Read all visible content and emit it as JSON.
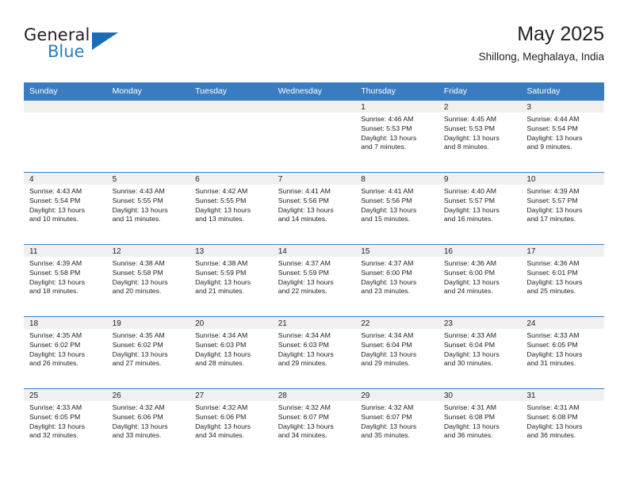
{
  "logo": {
    "word_top": "General",
    "word_bottom": "Blue",
    "triangle_color": "#1c6cb5",
    "blue_text_color": "#2b7cc1"
  },
  "header": {
    "title": "May 2025",
    "location": "Shillong, Meghalaya, India"
  },
  "theme": {
    "header_blue": "#3a7cc0",
    "daynum_strip_gray": "#f0f0f0",
    "text_color": "#222222"
  },
  "weekdays": [
    "Sunday",
    "Monday",
    "Tuesday",
    "Wednesday",
    "Thursday",
    "Friday",
    "Saturday"
  ],
  "weeks": [
    [
      {
        "day": "",
        "sunrise": "",
        "sunset": "",
        "daylight_line1": "",
        "daylight_line2": ""
      },
      {
        "day": "",
        "sunrise": "",
        "sunset": "",
        "daylight_line1": "",
        "daylight_line2": ""
      },
      {
        "day": "",
        "sunrise": "",
        "sunset": "",
        "daylight_line1": "",
        "daylight_line2": ""
      },
      {
        "day": "",
        "sunrise": "",
        "sunset": "",
        "daylight_line1": "",
        "daylight_line2": ""
      },
      {
        "day": "1",
        "sunrise": "Sunrise: 4:46 AM",
        "sunset": "Sunset: 5:53 PM",
        "daylight_line1": "Daylight: 13 hours",
        "daylight_line2": "and 7 minutes."
      },
      {
        "day": "2",
        "sunrise": "Sunrise: 4:45 AM",
        "sunset": "Sunset: 5:53 PM",
        "daylight_line1": "Daylight: 13 hours",
        "daylight_line2": "and 8 minutes."
      },
      {
        "day": "3",
        "sunrise": "Sunrise: 4:44 AM",
        "sunset": "Sunset: 5:54 PM",
        "daylight_line1": "Daylight: 13 hours",
        "daylight_line2": "and 9 minutes."
      }
    ],
    [
      {
        "day": "4",
        "sunrise": "Sunrise: 4:43 AM",
        "sunset": "Sunset: 5:54 PM",
        "daylight_line1": "Daylight: 13 hours",
        "daylight_line2": "and 10 minutes."
      },
      {
        "day": "5",
        "sunrise": "Sunrise: 4:43 AM",
        "sunset": "Sunset: 5:55 PM",
        "daylight_line1": "Daylight: 13 hours",
        "daylight_line2": "and 11 minutes."
      },
      {
        "day": "6",
        "sunrise": "Sunrise: 4:42 AM",
        "sunset": "Sunset: 5:55 PM",
        "daylight_line1": "Daylight: 13 hours",
        "daylight_line2": "and 13 minutes."
      },
      {
        "day": "7",
        "sunrise": "Sunrise: 4:41 AM",
        "sunset": "Sunset: 5:56 PM",
        "daylight_line1": "Daylight: 13 hours",
        "daylight_line2": "and 14 minutes."
      },
      {
        "day": "8",
        "sunrise": "Sunrise: 4:41 AM",
        "sunset": "Sunset: 5:56 PM",
        "daylight_line1": "Daylight: 13 hours",
        "daylight_line2": "and 15 minutes."
      },
      {
        "day": "9",
        "sunrise": "Sunrise: 4:40 AM",
        "sunset": "Sunset: 5:57 PM",
        "daylight_line1": "Daylight: 13 hours",
        "daylight_line2": "and 16 minutes."
      },
      {
        "day": "10",
        "sunrise": "Sunrise: 4:39 AM",
        "sunset": "Sunset: 5:57 PM",
        "daylight_line1": "Daylight: 13 hours",
        "daylight_line2": "and 17 minutes."
      }
    ],
    [
      {
        "day": "11",
        "sunrise": "Sunrise: 4:39 AM",
        "sunset": "Sunset: 5:58 PM",
        "daylight_line1": "Daylight: 13 hours",
        "daylight_line2": "and 18 minutes."
      },
      {
        "day": "12",
        "sunrise": "Sunrise: 4:38 AM",
        "sunset": "Sunset: 5:58 PM",
        "daylight_line1": "Daylight: 13 hours",
        "daylight_line2": "and 20 minutes."
      },
      {
        "day": "13",
        "sunrise": "Sunrise: 4:38 AM",
        "sunset": "Sunset: 5:59 PM",
        "daylight_line1": "Daylight: 13 hours",
        "daylight_line2": "and 21 minutes."
      },
      {
        "day": "14",
        "sunrise": "Sunrise: 4:37 AM",
        "sunset": "Sunset: 5:59 PM",
        "daylight_line1": "Daylight: 13 hours",
        "daylight_line2": "and 22 minutes."
      },
      {
        "day": "15",
        "sunrise": "Sunrise: 4:37 AM",
        "sunset": "Sunset: 6:00 PM",
        "daylight_line1": "Daylight: 13 hours",
        "daylight_line2": "and 23 minutes."
      },
      {
        "day": "16",
        "sunrise": "Sunrise: 4:36 AM",
        "sunset": "Sunset: 6:00 PM",
        "daylight_line1": "Daylight: 13 hours",
        "daylight_line2": "and 24 minutes."
      },
      {
        "day": "17",
        "sunrise": "Sunrise: 4:36 AM",
        "sunset": "Sunset: 6:01 PM",
        "daylight_line1": "Daylight: 13 hours",
        "daylight_line2": "and 25 minutes."
      }
    ],
    [
      {
        "day": "18",
        "sunrise": "Sunrise: 4:35 AM",
        "sunset": "Sunset: 6:02 PM",
        "daylight_line1": "Daylight: 13 hours",
        "daylight_line2": "and 26 minutes."
      },
      {
        "day": "19",
        "sunrise": "Sunrise: 4:35 AM",
        "sunset": "Sunset: 6:02 PM",
        "daylight_line1": "Daylight: 13 hours",
        "daylight_line2": "and 27 minutes."
      },
      {
        "day": "20",
        "sunrise": "Sunrise: 4:34 AM",
        "sunset": "Sunset: 6:03 PM",
        "daylight_line1": "Daylight: 13 hours",
        "daylight_line2": "and 28 minutes."
      },
      {
        "day": "21",
        "sunrise": "Sunrise: 4:34 AM",
        "sunset": "Sunset: 6:03 PM",
        "daylight_line1": "Daylight: 13 hours",
        "daylight_line2": "and 29 minutes."
      },
      {
        "day": "22",
        "sunrise": "Sunrise: 4:34 AM",
        "sunset": "Sunset: 6:04 PM",
        "daylight_line1": "Daylight: 13 hours",
        "daylight_line2": "and 29 minutes."
      },
      {
        "day": "23",
        "sunrise": "Sunrise: 4:33 AM",
        "sunset": "Sunset: 6:04 PM",
        "daylight_line1": "Daylight: 13 hours",
        "daylight_line2": "and 30 minutes."
      },
      {
        "day": "24",
        "sunrise": "Sunrise: 4:33 AM",
        "sunset": "Sunset: 6:05 PM",
        "daylight_line1": "Daylight: 13 hours",
        "daylight_line2": "and 31 minutes."
      }
    ],
    [
      {
        "day": "25",
        "sunrise": "Sunrise: 4:33 AM",
        "sunset": "Sunset: 6:05 PM",
        "daylight_line1": "Daylight: 13 hours",
        "daylight_line2": "and 32 minutes."
      },
      {
        "day": "26",
        "sunrise": "Sunrise: 4:32 AM",
        "sunset": "Sunset: 6:06 PM",
        "daylight_line1": "Daylight: 13 hours",
        "daylight_line2": "and 33 minutes."
      },
      {
        "day": "27",
        "sunrise": "Sunrise: 4:32 AM",
        "sunset": "Sunset: 6:06 PM",
        "daylight_line1": "Daylight: 13 hours",
        "daylight_line2": "and 34 minutes."
      },
      {
        "day": "28",
        "sunrise": "Sunrise: 4:32 AM",
        "sunset": "Sunset: 6:07 PM",
        "daylight_line1": "Daylight: 13 hours",
        "daylight_line2": "and 34 minutes."
      },
      {
        "day": "29",
        "sunrise": "Sunrise: 4:32 AM",
        "sunset": "Sunset: 6:07 PM",
        "daylight_line1": "Daylight: 13 hours",
        "daylight_line2": "and 35 minutes."
      },
      {
        "day": "30",
        "sunrise": "Sunrise: 4:31 AM",
        "sunset": "Sunset: 6:08 PM",
        "daylight_line1": "Daylight: 13 hours",
        "daylight_line2": "and 36 minutes."
      },
      {
        "day": "31",
        "sunrise": "Sunrise: 4:31 AM",
        "sunset": "Sunset: 6:08 PM",
        "daylight_line1": "Daylight: 13 hours",
        "daylight_line2": "and 36 minutes."
      }
    ]
  ]
}
